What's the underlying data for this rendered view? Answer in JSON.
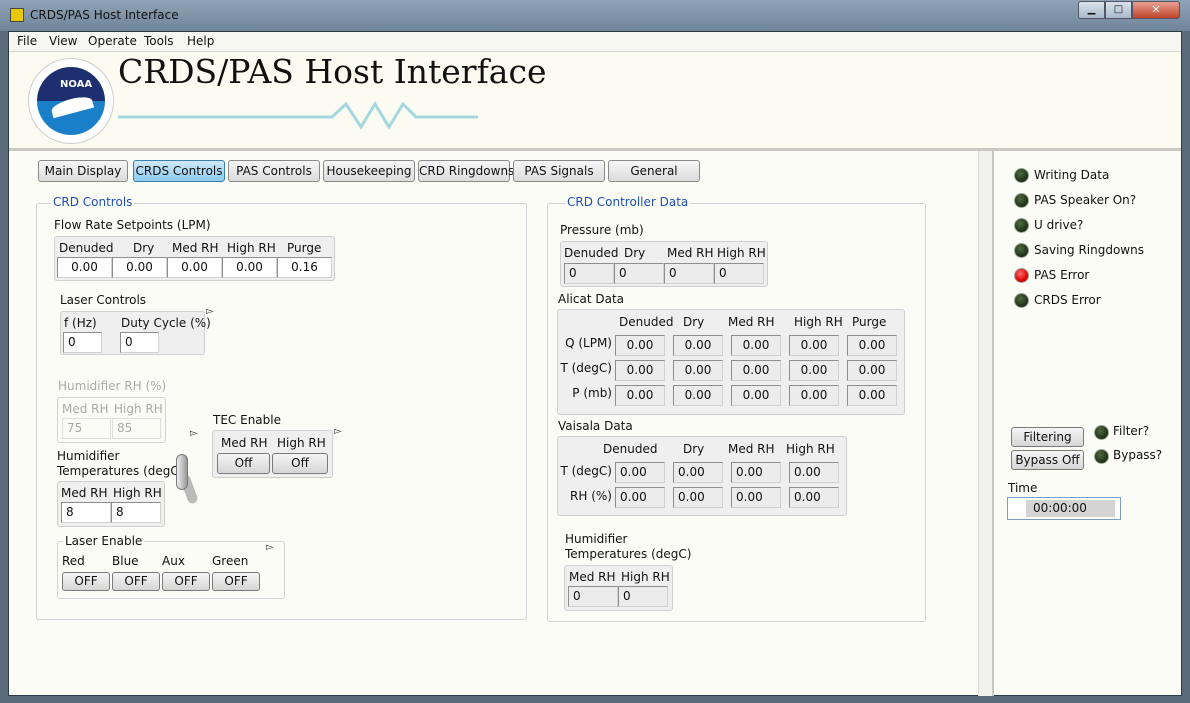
{
  "window": {
    "title": "CRDS/PAS Host Interface"
  },
  "menu": [
    "File",
    "View",
    "Operate",
    "Tools",
    "Help"
  ],
  "header": {
    "title": "CRDS/PAS Host Interface",
    "logo_text": "NOAA"
  },
  "tabs": [
    "Main Display",
    "CRDS Controls",
    "PAS Controls",
    "Housekeeping",
    "CRD Ringdowns",
    "PAS Signals",
    "General"
  ],
  "selected_tab": "CRDS Controls",
  "crd_controls": {
    "title": "CRD Controls",
    "flow": {
      "label": "Flow Rate Setpoints (LPM)",
      "headers": [
        "Denuded",
        "Dry",
        "Med RH",
        "High RH",
        "Purge"
      ],
      "values": [
        "0.00",
        "0.00",
        "0.00",
        "0.00",
        "0.16"
      ]
    },
    "laser_controls": {
      "label": "Laser Controls",
      "headers": [
        "f (Hz)",
        "Duty Cycle (%)"
      ],
      "values": [
        "0",
        "0"
      ]
    },
    "humidifier_rh": {
      "label": "Humidifier RH (%)",
      "headers": [
        "Med RH",
        "High RH"
      ],
      "values": [
        "75",
        "85"
      ]
    },
    "tec": {
      "label": "TEC Enable",
      "headers": [
        "Med RH",
        "High RH"
      ],
      "values": [
        "Off",
        "Off"
      ]
    },
    "hum_temp": {
      "label1": "Humidifier",
      "label2": "Temperatures (degC)",
      "headers": [
        "Med RH",
        "High RH"
      ],
      "values": [
        "8",
        "8"
      ]
    },
    "laser_enable": {
      "label": "Laser Enable",
      "headers": [
        "Red",
        "Blue",
        "Aux",
        "Green"
      ],
      "values": [
        "OFF",
        "OFF",
        "OFF",
        "OFF"
      ]
    }
  },
  "controller": {
    "title": "CRD Controller Data",
    "pressure": {
      "label": "Pressure (mb)",
      "headers": [
        "Denuded",
        "Dry",
        "Med RH",
        "High RH"
      ],
      "values": [
        "0",
        "0",
        "0",
        "0"
      ]
    },
    "alicat": {
      "label": "Alicat Data",
      "headers": [
        "Denuded",
        "Dry",
        "Med RH",
        "High RH",
        "Purge"
      ],
      "rows": [
        "Q (LPM)",
        "T (degC)",
        "P (mb)"
      ],
      "values": [
        [
          "0.00",
          "0.00",
          "0.00",
          "0.00",
          "0.00"
        ],
        [
          "0.00",
          "0.00",
          "0.00",
          "0.00",
          "0.00"
        ],
        [
          "0.00",
          "0.00",
          "0.00",
          "0.00",
          "0.00"
        ]
      ]
    },
    "vaisala": {
      "label": "Vaisala Data",
      "headers": [
        "Denuded",
        "Dry",
        "Med RH",
        "High RH"
      ],
      "rows": [
        "T (degC)",
        "RH (%)"
      ],
      "values": [
        [
          "0.00",
          "0.00",
          "0.00",
          "0.00"
        ],
        [
          "0.00",
          "0.00",
          "0.00",
          "0.00"
        ]
      ]
    },
    "hum_temp": {
      "label1": "Humidifier",
      "label2": "Temperatures (degC)",
      "headers": [
        "Med RH",
        "High RH"
      ],
      "values": [
        "0",
        "0"
      ]
    }
  },
  "status": {
    "indicators": [
      {
        "label": "Writing Data",
        "on": false
      },
      {
        "label": "PAS Speaker On?",
        "on": false
      },
      {
        "label": "U drive?",
        "on": false
      },
      {
        "label": "Saving Ringdowns",
        "on": false
      },
      {
        "label": "PAS Error",
        "on": true
      },
      {
        "label": "CRDS Error",
        "on": false
      }
    ],
    "filter_button": "Filtering",
    "bypass_button": "Bypass Off",
    "filter_label": "Filter?",
    "bypass_label": "Bypass?",
    "time_label": "Time",
    "time_value": "00:00:00"
  },
  "colors": {
    "accent": "#1f4fb5",
    "tab_selected": "#8ccbef",
    "led_off": "#1c2e14",
    "led_error": "#e00000"
  }
}
